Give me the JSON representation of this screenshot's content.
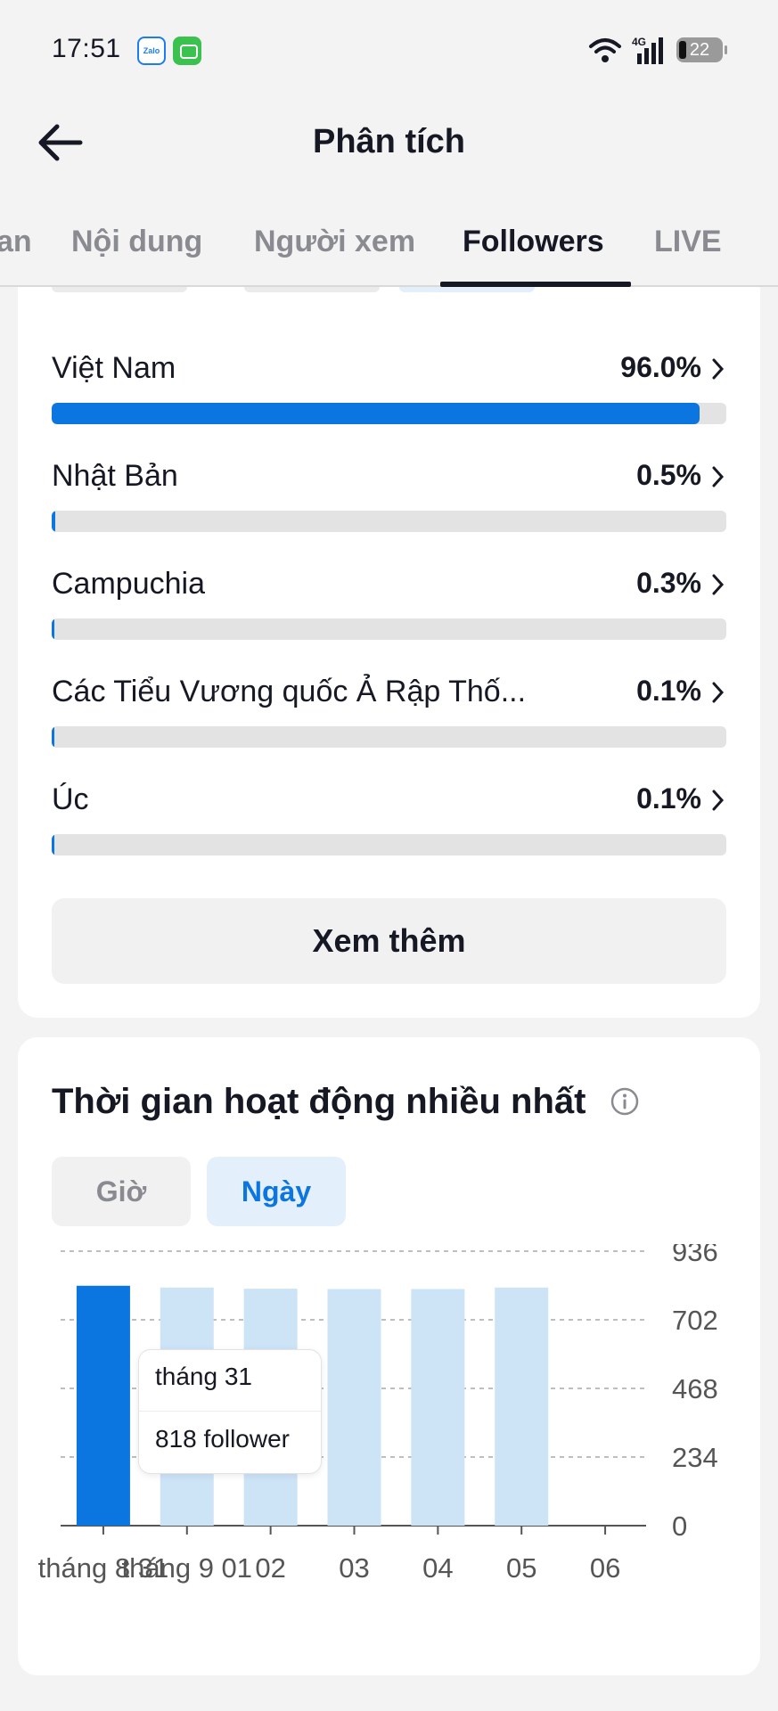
{
  "status_bar": {
    "time": "17:51",
    "apps": [
      "zalo-icon",
      "messages-icon"
    ],
    "zalo_text": "Zalo",
    "network": "4G",
    "battery": "22"
  },
  "header": {
    "title": "Phân tích",
    "back_icon": "arrow-left-icon"
  },
  "tabs": [
    {
      "label": "an",
      "active": false
    },
    {
      "label": "Nội dung",
      "active": false
    },
    {
      "label": "Người xem",
      "active": false
    },
    {
      "label": "Followers",
      "active": true
    },
    {
      "label": "LIVE",
      "active": false
    }
  ],
  "countries": [
    {
      "name": "Việt Nam",
      "percent": "96.0%",
      "share": 0.96
    },
    {
      "name": "Nhật Bản",
      "percent": "0.5%",
      "share": 0.005
    },
    {
      "name": "Campuchia",
      "percent": "0.3%",
      "share": 0.003
    },
    {
      "name": "Các Tiểu Vương quốc Ả Rập Thố...",
      "percent": "0.1%",
      "share": 0.001
    },
    {
      "name": "Úc",
      "percent": "0.1%",
      "share": 0.001
    }
  ],
  "more_button": "Xem thêm",
  "activity": {
    "title": "Thời gian hoạt động nhiều nhất",
    "toggles": {
      "hour": "Giờ",
      "day": "Ngày"
    },
    "selected_toggle": "day",
    "accent": "#0b75e0",
    "bar_light": "#cde3f6",
    "tooltip": {
      "date": "tháng 31",
      "value": "818 follower"
    }
  },
  "chart_data": {
    "type": "bar",
    "categories": [
      "tháng 8 31",
      "tháng 9 01",
      "02",
      "03",
      "04",
      "05",
      "06"
    ],
    "x_tick_labels": [
      "tháng 8 31",
      "tháng 9 01",
      "02",
      "03",
      "04",
      "05",
      "06"
    ],
    "values": [
      818,
      812,
      808,
      807,
      807,
      812,
      null
    ],
    "highlighted_index": 0,
    "y_ticks": [
      0,
      234,
      468,
      702,
      936
    ],
    "ylim": [
      0,
      936
    ],
    "grid": true,
    "y_axis_side": "right"
  }
}
